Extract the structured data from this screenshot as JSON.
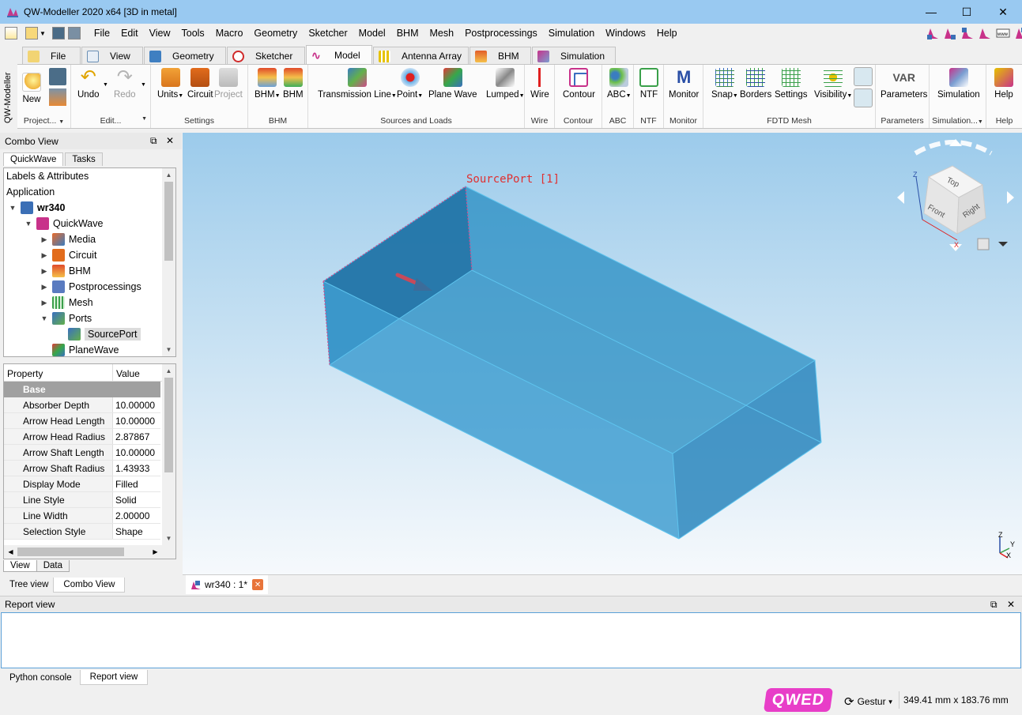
{
  "window": {
    "title": "QW-Modeller 2020 x64 [3D in metal]",
    "minimize": "—",
    "maximize": "☐",
    "close": "✕"
  },
  "menu": [
    "File",
    "Edit",
    "View",
    "Tools",
    "Macro",
    "Geometry",
    "Sketcher",
    "Model",
    "BHM",
    "Mesh",
    "Postprocessings",
    "Simulation",
    "Windows",
    "Help"
  ],
  "side_label": "QW-Modeller",
  "side_close": "✕",
  "ribbon_tabs": [
    {
      "label": "File",
      "icon": "file-icon"
    },
    {
      "label": "View",
      "icon": "view-cube-icon"
    },
    {
      "label": "Geometry",
      "icon": "geometry-icon"
    },
    {
      "label": "Sketcher",
      "icon": "sketcher-icon"
    },
    {
      "label": "Model",
      "icon": "model-icon"
    },
    {
      "label": "Antenna Array",
      "icon": "antenna-array-icon"
    },
    {
      "label": "BHM",
      "icon": "bhm-icon"
    },
    {
      "label": "Simulation",
      "icon": "simulation-icon"
    }
  ],
  "ribbon": {
    "project": {
      "label": "Project...",
      "new": "New"
    },
    "edit": {
      "label": "Edit...",
      "undo": "Undo",
      "redo": "Redo"
    },
    "settings": {
      "label": "Settings",
      "units": "Units",
      "circuit": "Circuit",
      "project": "Project"
    },
    "bhm": {
      "label": "BHM",
      "bhm1": "BHM",
      "bhm2": "BHM"
    },
    "sources": {
      "label": "Sources and Loads",
      "tline": "Transmission Line",
      "point": "Point",
      "plane": "Plane Wave",
      "lumped": "Lumped"
    },
    "wire": {
      "label": "Wire",
      "btn": "Wire"
    },
    "contour": {
      "label": "Contour",
      "btn": "Contour"
    },
    "abc": {
      "label": "ABC",
      "btn": "ABC"
    },
    "ntf": {
      "label": "NTF",
      "btn": "NTF"
    },
    "monitor": {
      "label": "Monitor",
      "btn": "Monitor"
    },
    "fdtd": {
      "label": "FDTD Mesh",
      "snap": "Snap",
      "borders": "Borders",
      "settings": "Settings",
      "visibility": "Visibility"
    },
    "parameters": {
      "label": "Parameters",
      "btn": "Parameters",
      "icon_text": "VAR"
    },
    "simulation": {
      "label": "Simulation...",
      "btn": "Simulation"
    },
    "help": {
      "label": "Help",
      "btn": "Help"
    }
  },
  "combo": {
    "title": "Combo View",
    "tabs": [
      "QuickWave",
      "Tasks"
    ],
    "tree": [
      {
        "label": "Labels & Attributes",
        "level": 0,
        "twist": "",
        "icon": ""
      },
      {
        "label": "Application",
        "level": 0,
        "twist": "",
        "icon": ""
      },
      {
        "label": "wr340",
        "level": 0,
        "twist": "v",
        "icon": "document-icon",
        "bold": true
      },
      {
        "label": "QuickWave",
        "level": 1,
        "twist": "v",
        "icon": "quickwave-icon"
      },
      {
        "label": "Media",
        "level": 2,
        "twist": ">",
        "icon": "media-icon"
      },
      {
        "label": "Circuit",
        "level": 2,
        "twist": ">",
        "icon": "circuit-icon"
      },
      {
        "label": "BHM",
        "level": 2,
        "twist": ">",
        "icon": "bhm-icon"
      },
      {
        "label": "Postprocessings",
        "level": 2,
        "twist": ">",
        "icon": "postprocessings-icon"
      },
      {
        "label": "Mesh",
        "level": 2,
        "twist": ">",
        "icon": "mesh-icon"
      },
      {
        "label": "Ports",
        "level": 2,
        "twist": "v",
        "icon": "ports-icon"
      },
      {
        "label": "SourcePort",
        "level": 3,
        "twist": "",
        "icon": "port-icon",
        "selected": true
      },
      {
        "label": "PlaneWave",
        "level": 2,
        "twist": "",
        "icon": "planewave-icon"
      }
    ],
    "props_header": {
      "property": "Property",
      "value": "Value"
    },
    "props_group": "Base",
    "props": [
      {
        "name": "Absorber Depth",
        "value": "10.00000"
      },
      {
        "name": "Arrow Head Length",
        "value": "10.00000"
      },
      {
        "name": "Arrow Head Radius",
        "value": "2.87867"
      },
      {
        "name": "Arrow Shaft Length",
        "value": "10.00000"
      },
      {
        "name": "Arrow Shaft Radius",
        "value": "1.43933"
      },
      {
        "name": "Display Mode",
        "value": "Filled"
      },
      {
        "name": "Line Style",
        "value": "Solid"
      },
      {
        "name": "Line Width",
        "value": "2.00000"
      },
      {
        "name": "Selection Style",
        "value": "Shape"
      }
    ],
    "bottom_tabs": [
      "View",
      "Data"
    ]
  },
  "left_bottom_tabs": [
    "Tree view",
    "Combo View"
  ],
  "viewport": {
    "label": "SourcePort [1]",
    "cube_faces": {
      "top": "Top",
      "front": "Front",
      "right": "Right"
    },
    "axis": {
      "z": "Z",
      "y": "Y",
      "x": "X"
    }
  },
  "doc_tab": "wr340 : 1*",
  "report": {
    "title": "Report view",
    "tabs": [
      "Python console",
      "Report view"
    ]
  },
  "status": {
    "nav": "Gestur",
    "dims": "349.41 mm x 183.76 mm",
    "logo": "QWED"
  },
  "colors": {
    "titlebar": "#99c9f1",
    "box": "#2c8fc4",
    "label": "#e03030"
  }
}
